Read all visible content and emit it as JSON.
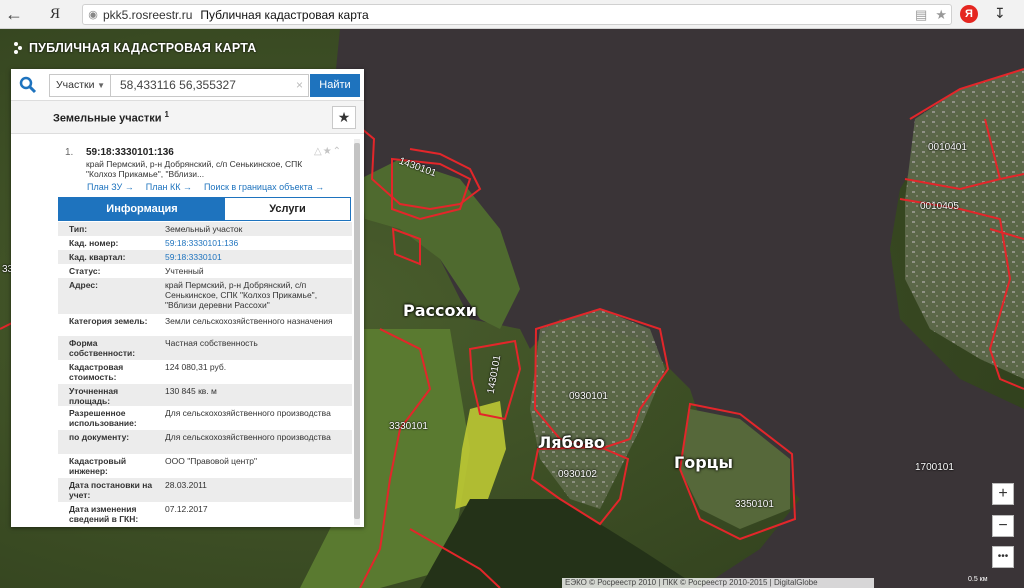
{
  "browser": {
    "back_icon": "arrow-left-icon",
    "logo": "Я",
    "url_domain": "pkk5.rosreestr.ru",
    "page_title": "Публичная кадастровая карта",
    "ya_badge": "Я",
    "download_icon": "download-icon"
  },
  "app": {
    "title": "ПУБЛИЧНАЯ КАДАСТРОВАЯ КАРТА"
  },
  "search": {
    "type_value": "Участки",
    "query": "58,433116 56,355327",
    "find_label": "Найти"
  },
  "results": {
    "title": "Земельные участки",
    "count": "1"
  },
  "card": {
    "index": "1.",
    "cad_number": "59:18:3330101:136",
    "address": "край Пермский, р-н Добрянский, с/п Сенькинское, СПК \"Колхоз Прикамье\", \"Вблизи...",
    "links": [
      "План ЗУ →",
      "План КК →",
      "Поиск в границах объекта →"
    ]
  },
  "tabs": {
    "info": "Информация",
    "services": "Услуги"
  },
  "info": [
    {
      "k": "Тип:",
      "v": "Земельный участок"
    },
    {
      "k": "Кад. номер:",
      "v": "59:18:3330101:136"
    },
    {
      "k": "Кад. квартал:",
      "v": "59:18:3330101"
    },
    {
      "k": "Статус:",
      "v": "Учтенный"
    },
    {
      "k": "Адрес:",
      "v": "край Пермский, р-н Добрянский, с/п Сенькинское, СПК \"Колхоз Прикамье\", \"Вблизи деревни Рассохи\""
    },
    {
      "k": "Категория земель:",
      "v": "Земли сельскохозяйственного назначения"
    },
    {
      "k": "Форма собственности:",
      "v": "Частная собственность"
    },
    {
      "k": "Кадастровая стоимость:",
      "v": "124 080,31 руб."
    },
    {
      "k": "Уточненная площадь:",
      "v": "130 845 кв. м"
    },
    {
      "k": "Разрешенное использование:",
      "v": "Для сельскохозяйственного производства"
    },
    {
      "k": "по документу:",
      "v": "Для сельскохозяйственного производства"
    },
    {
      "k": "Кадастровый инженер:",
      "v": "ООО \"Правовой центр\""
    },
    {
      "k": "Дата постановки на учет:",
      "v": "28.03.2011"
    },
    {
      "k": "Дата изменения сведений в ГКН:",
      "v": "07.12.2017"
    }
  ],
  "map": {
    "places": [
      "Рассохи",
      "Лябово",
      "Горцы"
    ],
    "cad_labels": [
      "3330101",
      "1430101",
      "0010401",
      "0010405",
      "3330101",
      "0930101",
      "0930102",
      "3350101",
      "1700101",
      "1430101"
    ],
    "zoom_in": "+",
    "zoom_out": "−",
    "more": "•••",
    "attribution": "ЕЭКО © Росреестр 2010 | ПКК © Росреестр 2010-2015 | DigitalGlobe",
    "scale": "0.5 км"
  },
  "colors": {
    "accent": "#1e73be",
    "parcel_border": "#e3262a",
    "water": "#3b3538"
  }
}
